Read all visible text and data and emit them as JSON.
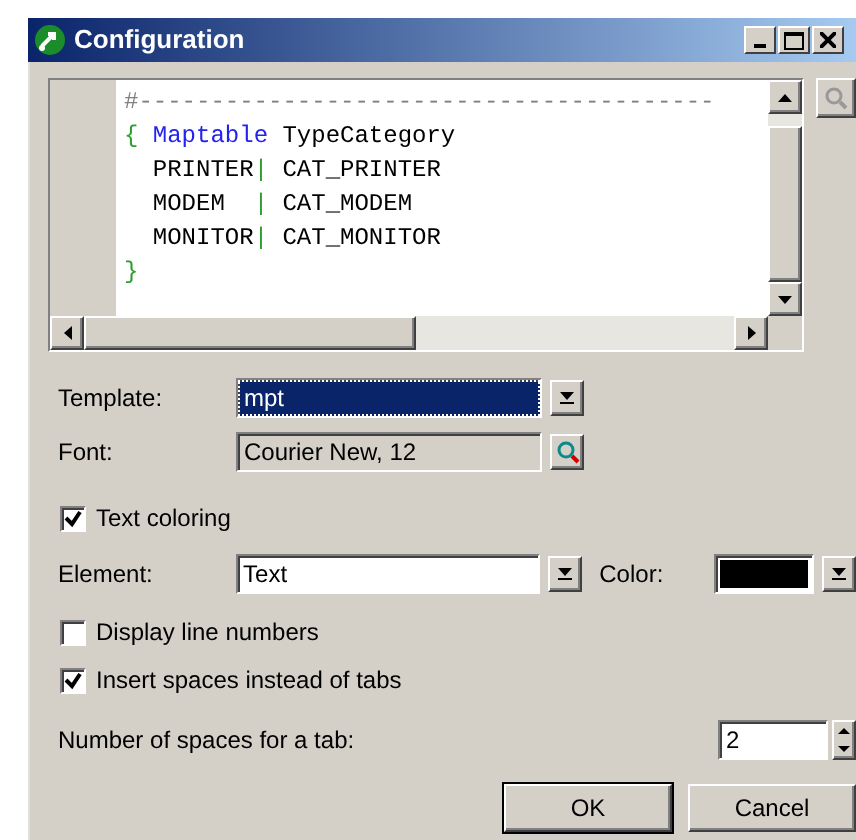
{
  "window": {
    "title": "Configuration"
  },
  "editor": {
    "lines": [
      [
        {
          "kind": "comment",
          "text": "#----------------------------------------"
        }
      ],
      [
        {
          "kind": "punct",
          "text": "{"
        },
        {
          "kind": "keyword",
          "text": " Maptable"
        },
        {
          "kind": "text",
          "text": " TypeCategory"
        }
      ],
      [
        {
          "kind": "text",
          "text": "  PRINTER"
        },
        {
          "kind": "punct",
          "text": "|"
        },
        {
          "kind": "text",
          "text": " CAT_PRINTER"
        }
      ],
      [
        {
          "kind": "text",
          "text": "  MODEM  "
        },
        {
          "kind": "punct",
          "text": "|"
        },
        {
          "kind": "text",
          "text": " CAT_MODEM"
        }
      ],
      [
        {
          "kind": "text",
          "text": "  MONITOR"
        },
        {
          "kind": "punct",
          "text": "|"
        },
        {
          "kind": "text",
          "text": " CAT_MONITOR"
        }
      ],
      [
        {
          "kind": "punct",
          "text": "}"
        }
      ]
    ]
  },
  "template": {
    "label": "Template:",
    "value": "mpt",
    "selected": true
  },
  "font": {
    "label": "Font:",
    "value": "Courier New, 12"
  },
  "text_coloring": {
    "label": "Text coloring",
    "checked": true
  },
  "element": {
    "label": "Element:",
    "value": "Text"
  },
  "color": {
    "label": "Color:",
    "color": "#000000"
  },
  "display_line_numbers": {
    "label": "Display line numbers",
    "checked": false
  },
  "insert_spaces": {
    "label": "Insert spaces instead of tabs",
    "checked": true
  },
  "tab_spaces": {
    "label": "Number of spaces for a tab:",
    "value": "2"
  },
  "buttons": [
    {
      "label": "OK",
      "default": true
    },
    {
      "label": "Cancel",
      "default": false
    }
  ]
}
